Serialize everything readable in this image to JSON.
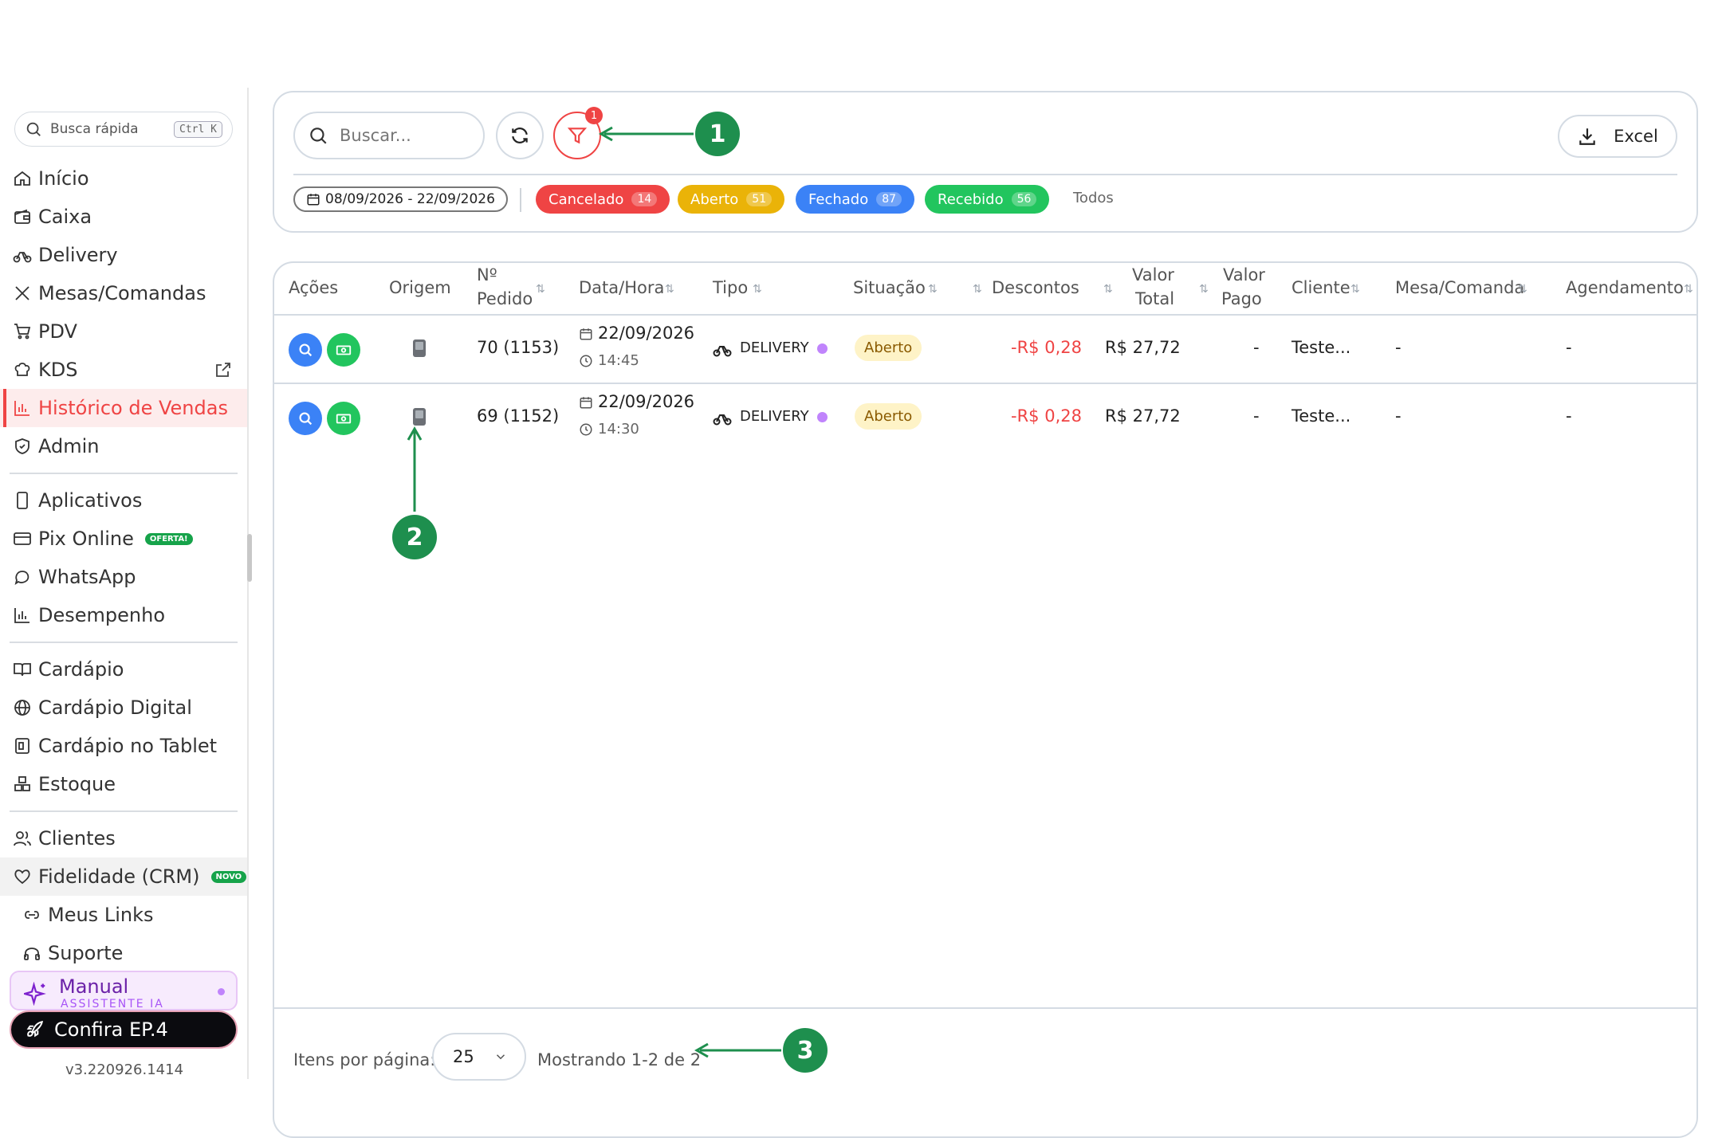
{
  "sidebar": {
    "quick_search": {
      "placeholder": "Busca rápida",
      "shortcut": "Ctrl K"
    },
    "items": [
      {
        "label": "Início"
      },
      {
        "label": "Caixa"
      },
      {
        "label": "Delivery"
      },
      {
        "label": "Mesas/Comandas"
      },
      {
        "label": "PDV"
      },
      {
        "label": "KDS"
      },
      {
        "label": "Histórico de Vendas"
      },
      {
        "label": "Admin"
      },
      {
        "label": "Aplicativos"
      },
      {
        "label": "Pix Online",
        "badge": "OFERTA!"
      },
      {
        "label": "WhatsApp"
      },
      {
        "label": "Desempenho"
      },
      {
        "label": "Cardápio"
      },
      {
        "label": "Cardápio Digital"
      },
      {
        "label": "Cardápio no Tablet"
      },
      {
        "label": "Estoque"
      },
      {
        "label": "Clientes"
      },
      {
        "label": "Fidelidade (CRM)",
        "badge": "NOVO"
      },
      {
        "label": "Meus Links"
      },
      {
        "label": "Suporte"
      }
    ],
    "manual": {
      "title": "Manual",
      "subtitle": "ASSISTENTE IA"
    },
    "confira": "Confira EP.4",
    "version": "v3.220926.1414"
  },
  "filters": {
    "search_placeholder": "Buscar...",
    "filter_count": "1",
    "excel_label": "Excel",
    "date_range": "08/09/2026 - 22/09/2026",
    "statuses": [
      {
        "label": "Cancelado",
        "count": "14",
        "color": "#ef4444"
      },
      {
        "label": "Aberto",
        "count": "51",
        "color": "#eab308"
      },
      {
        "label": "Fechado",
        "count": "87",
        "color": "#3b82f6"
      },
      {
        "label": "Recebido",
        "count": "56",
        "color": "#22c55e"
      }
    ],
    "todos": "Todos"
  },
  "table": {
    "headers": {
      "acoes": "Ações",
      "origem": "Origem",
      "pedido_1": "Nº",
      "pedido_2": "Pedido",
      "datahora": "Data/Hora",
      "tipo": "Tipo",
      "situacao": "Situação",
      "descontos": "Descontos",
      "valor_total_1": "Valor",
      "valor_total_2": "Total",
      "valor_pago_1": "Valor",
      "valor_pago_2": "Pago",
      "cliente": "Cliente",
      "mesa": "Mesa/Comanda",
      "agendamento": "Agendamento"
    },
    "rows": [
      {
        "pedido": "70 (1153)",
        "date": "22/09/2026",
        "time": "14:45",
        "tipo": "DELIVERY",
        "situacao": "Aberto",
        "descontos": "-R$ 0,28",
        "valor_total": "R$ 27,72",
        "valor_pago": "-",
        "cliente": "Teste...",
        "mesa": "-",
        "agendamento": "-"
      },
      {
        "pedido": "69 (1152)",
        "date": "22/09/2026",
        "time": "14:30",
        "tipo": "DELIVERY",
        "situacao": "Aberto",
        "descontos": "-R$ 0,28",
        "valor_total": "R$ 27,72",
        "valor_pago": "-",
        "cliente": "Teste...",
        "mesa": "-",
        "agendamento": "-"
      }
    ],
    "footer": {
      "per_page_label": "Itens por página:",
      "per_page_value": "25",
      "showing": "Mostrando 1-2 de 2"
    }
  },
  "annotations": [
    "1",
    "2",
    "3"
  ],
  "colors": {
    "accent": "#ef4444",
    "annotation": "#1e8f4e",
    "blue": "#3b82f6",
    "green": "#22c55e"
  }
}
